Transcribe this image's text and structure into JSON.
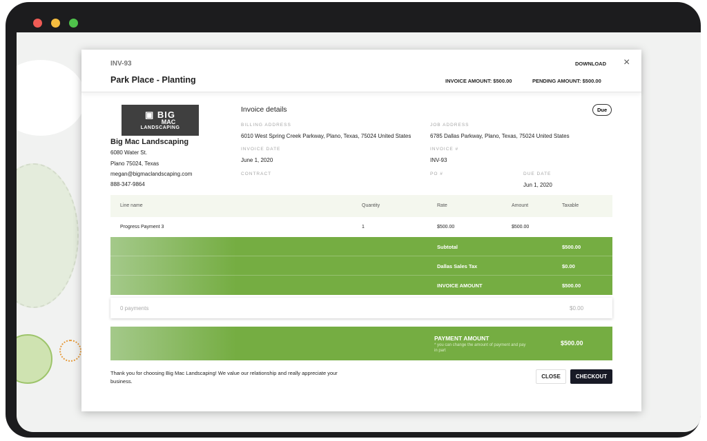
{
  "header": {
    "invoice_id": "INV-93",
    "title": "Park Place - Planting",
    "download": "DOWNLOAD",
    "close_icon": "×",
    "invoice_amount": "INVOICE AMOUNT: $500.00",
    "pending_amount": "PENDING AMOUNT: $500.00"
  },
  "company": {
    "logo_text": "BIG MAC LANDSCAPING",
    "name": "Big Mac Landscaping",
    "street": "6080 Water St.",
    "city": "Plano 75024, Texas",
    "email": "megan@bigmaclandscaping.com",
    "phone": "888-347-9864"
  },
  "details": {
    "title": "Invoice details",
    "status": "Due",
    "billing_label": "BILLING ADDRESS",
    "billing": "6010 West Spring Creek Parkway, Plano, Texas, 75024 United States",
    "job_label": "JOB ADDRESS",
    "job": "6785 Dallas Parkway, Plano, Texas, 75024 United States",
    "date_label": "INVOICE DATE",
    "date": "June 1, 2020",
    "num_label": "INVOICE #",
    "num": "INV-93",
    "contract_label": "CONTRACT",
    "po_label": "PO #",
    "due_label": "DUE DATE",
    "due": "Jun 1, 2020"
  },
  "table": {
    "headers": [
      "Line name",
      "Quantity",
      "Rate",
      "Amount",
      "Taxable"
    ],
    "rows": [
      [
        "Progress Payment 3",
        "1",
        "$500.00",
        "$500.00",
        ""
      ]
    ]
  },
  "totals": [
    {
      "label": "Subtotal",
      "value": "$500.00"
    },
    {
      "label": "Dallas Sales Tax",
      "value": "$0.00"
    },
    {
      "label": "INVOICE AMOUNT",
      "value": "$500.00"
    }
  ],
  "payments": {
    "label": "0 payments",
    "value": "$0.00"
  },
  "payment_amount": {
    "label": "PAYMENT AMOUNT",
    "note": "* you can change the amount of payment and pay in part",
    "value": "$500.00"
  },
  "footer": {
    "message": "Thank you for choosing Big Mac Landscaping! We value our relationship and really appreciate your business.",
    "close": "CLOSE",
    "checkout": "CHECKOUT"
  }
}
